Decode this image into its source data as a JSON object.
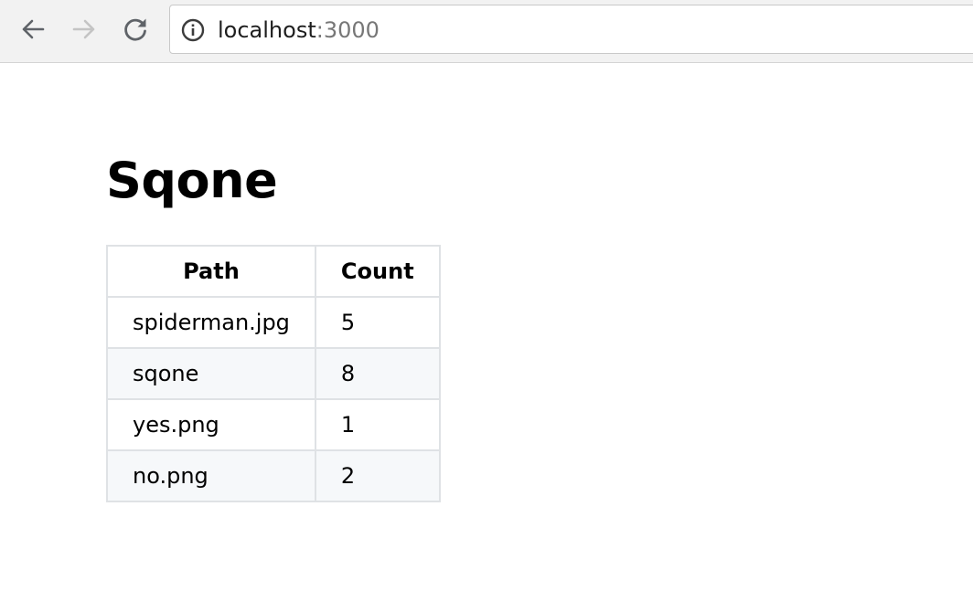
{
  "browser": {
    "url_host": "localhost",
    "url_port": ":3000",
    "icons": {
      "back": "arrow-left-icon",
      "forward": "arrow-right-icon",
      "reload": "reload-icon",
      "info": "info-icon"
    },
    "colors": {
      "toolbar_bg": "#f2f2f2",
      "icon_active": "#5f6368",
      "icon_disabled": "#c4c4c4"
    }
  },
  "page": {
    "title": "Sqone",
    "table": {
      "headers": [
        "Path",
        "Count"
      ],
      "rows": [
        [
          "spiderman.jpg",
          "5"
        ],
        [
          "sqone",
          "8"
        ],
        [
          "yes.png",
          "1"
        ],
        [
          "no.png",
          "2"
        ]
      ]
    }
  }
}
